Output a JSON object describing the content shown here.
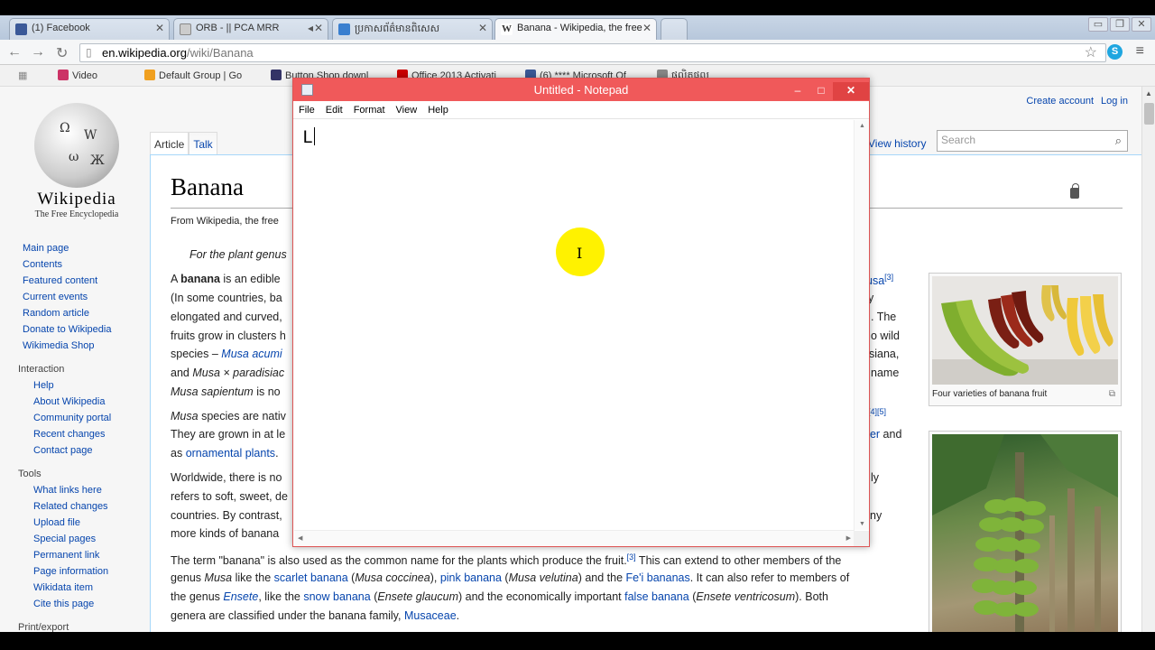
{
  "browser": {
    "tabs": [
      {
        "label": "(1) Facebook",
        "favicon_color": "#3b5998"
      },
      {
        "label": "ORB - || PCA MRR",
        "favicon_color": "#bbbbbb"
      },
      {
        "label": "ប្រកាសព័ត៌មានពិសេស",
        "favicon_color": "#3a7fcf"
      },
      {
        "label": "Banana - Wikipedia, the free",
        "favicon_color": "#555555"
      }
    ],
    "url_domain": "en.wikipedia.org",
    "url_path": "/wiki/Banana",
    "bookmarks": [
      {
        "label": "Video",
        "color": "#cc3366"
      },
      {
        "label": "Default Group | Go",
        "color": "#f0a020"
      },
      {
        "label": "Button Shop downl",
        "color": "#333366"
      },
      {
        "label": "Office 2013 Activati",
        "color": "#cc0000"
      },
      {
        "label": "(6) **** Microsoft Of",
        "color": "#3b5998"
      },
      {
        "label": "ផលិតផល",
        "color": "#888888"
      }
    ]
  },
  "wiki": {
    "wordmark": "Wikipedia",
    "tagline": "The Free Encyclopedia",
    "nav_main": [
      "Main page",
      "Contents",
      "Featured content",
      "Current events",
      "Random article",
      "Donate to Wikipedia",
      "Wikimedia Shop"
    ],
    "interaction_heading": "Interaction",
    "nav_interaction": [
      "Help",
      "About Wikipedia",
      "Community portal",
      "Recent changes",
      "Contact page"
    ],
    "tools_heading": "Tools",
    "nav_tools": [
      "What links here",
      "Related changes",
      "Upload file",
      "Special pages",
      "Permanent link",
      "Page information",
      "Wikidata item",
      "Cite this page"
    ],
    "print_heading": "Print/export",
    "create_account": "Create account",
    "login": "Log in",
    "tab_article": "Article",
    "tab_talk": "Talk",
    "view_history": "View history",
    "search_placeholder": "Search",
    "title": "Banana",
    "from_wiki": "From Wikipedia, the free",
    "hatnote": "For the plant genus",
    "p1": {
      "a": "A",
      "bold": "banana",
      "b": "is an edible",
      "l2": "(In some countries, ba",
      "l3": "elongated and curved,",
      "l4": "fruits grow in clusters h",
      "l5a": "species –",
      "l5b": "Musa acumi",
      "l6a": "and",
      "l6b": "Musa × paradisiac",
      "l7a": "Musa sapientum",
      "l7b": "is no",
      "r1": "usa",
      "r1sup": "[3]",
      "r2": "y",
      "r3": ". The",
      "r4": "o wild",
      "r5": "siana,",
      "r6": "name"
    },
    "p2": {
      "l1a": "Musa",
      "l1b": "species are nativ",
      "l2": "They are grown in at le",
      "l3a": "as",
      "l3b": "ornamental plants",
      "l3c": ".",
      "r1": "[4][5]",
      "r2a": "eer",
      "r2b": " and"
    },
    "p3": {
      "l1": "Worldwide, there is no",
      "l2": "refers to soft, sweet, de",
      "l3": "countries. By contrast,",
      "l4": "more kinds of banana",
      "r1": "ly",
      "r3": "ny"
    },
    "p4": {
      "t1": "The term \"banana\" is also used as the common name for the plants which produce the fruit.",
      "s1": "[3]",
      "t2": " This can extend to other members of the",
      "t3": "genus ",
      "t3i": "Musa",
      "t3b": " like the ",
      "l1": "scarlet banana",
      "t4": " (",
      "t4i": "Musa coccinea",
      "t4b": "), ",
      "l2": "pink banana",
      "t5": " (",
      "t5i": "Musa velutina",
      "t5b": ") and the ",
      "l3": "Fe'i bananas",
      "t6": ". It can also refer to members of",
      "t7": "the genus ",
      "l4": "Ensete",
      "t8": ", like the ",
      "l5": "snow banana",
      "t9": " (",
      "t9i": "Ensete glaucum",
      "t9b": ") and the economically important ",
      "l6": "false banana",
      "t10": " (",
      "t10i": "Ensete ventricosum",
      "t10b": "). Both",
      "t11": "genera are classified under the banana family, ",
      "l7": "Musaceae",
      "t12": "."
    },
    "caption1": "Four varieties of banana fruit"
  },
  "notepad": {
    "title": "Untitled - Notepad",
    "menu": [
      "File",
      "Edit",
      "Format",
      "View",
      "Help"
    ],
    "text": "L",
    "minimize": "–",
    "maximize": "□",
    "close": "✕"
  },
  "colors": {
    "notepad_title": "#f0595a",
    "link": "#0645ad",
    "cursor_highlight": "#fff200"
  }
}
